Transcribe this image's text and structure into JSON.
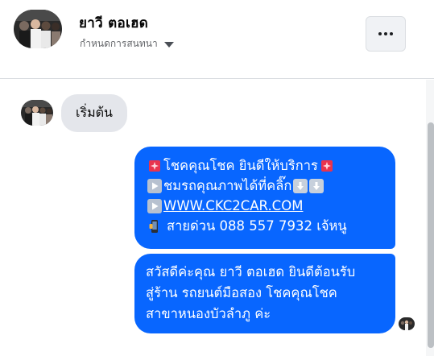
{
  "header": {
    "contact_name": "ยาวี ตอเฮด",
    "conversation_settings": "กำหนดการสนทนา",
    "more_label": "More options"
  },
  "conversation": {
    "start_label": "เริ่มต้น",
    "messages": [
      {
        "lines": {
          "l1": "โชคคุณโชค ยินดีให้บริการ",
          "l2": "ชมรถคุณภาพได้ที่คลิ๊ก",
          "l3": "WWW.CKC2CAR.COM",
          "l4": "สายด่วน 088 557 7932 เจ้หนู"
        }
      },
      {
        "lines": {
          "l1": "สวัสดีค่ะคุณ ยาวี ตอเฮด ยินดีต้อนรับ",
          "l2": "สู่ร้าน รถยนต์มือสอง โชคคุณโชค",
          "l3": "สาขาหนองบัวลำภู ค่ะ"
        }
      }
    ]
  },
  "colors": {
    "bubble_blue": "#0866FF",
    "incoming_gray": "#E4E6EB",
    "text_dark": "#050505",
    "text_muted": "#65676B",
    "emoji_red": "#E8344E"
  },
  "icons": {
    "more": "three-dots-icon",
    "caret": "caret-down-icon",
    "sparkle": "sparkle-emoji-icon",
    "play": "play-button-emoji-icon",
    "down": "down-arrow-emoji-icon",
    "phone": "mobile-phone-emoji-icon"
  }
}
